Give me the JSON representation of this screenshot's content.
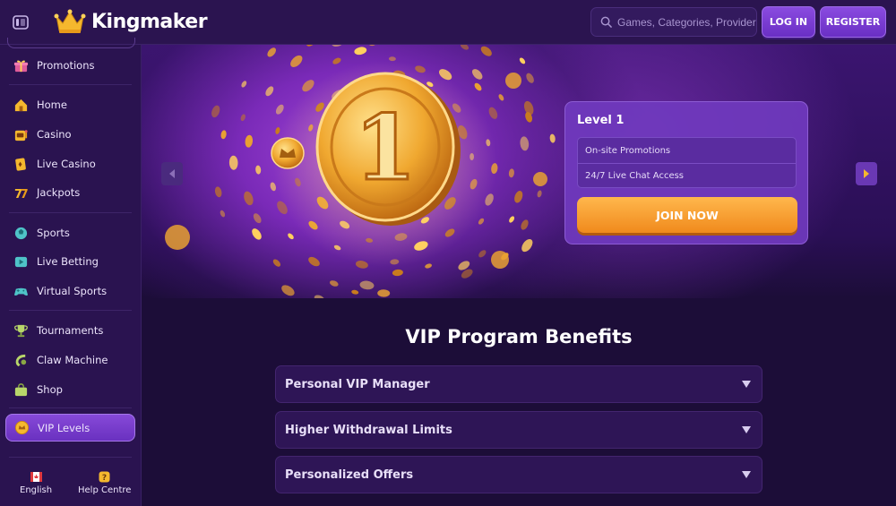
{
  "header": {
    "brand": "Kingmaker",
    "search_placeholder": "Games, Categories, Providers",
    "login_label": "LOG IN",
    "register_label": "REGISTER"
  },
  "sidebar": {
    "items": [
      {
        "label": "Promotions",
        "icon": "gift-icon"
      },
      {
        "label": "Home",
        "icon": "home-icon"
      },
      {
        "label": "Casino",
        "icon": "casino-icon"
      },
      {
        "label": "Live Casino",
        "icon": "live-casino-icon"
      },
      {
        "label": "Jackpots",
        "icon": "jackpots-icon"
      },
      {
        "label": "Sports",
        "icon": "sports-icon"
      },
      {
        "label": "Live Betting",
        "icon": "live-betting-icon"
      },
      {
        "label": "Virtual Sports",
        "icon": "gamepad-icon"
      },
      {
        "label": "Tournaments",
        "icon": "trophy-icon"
      },
      {
        "label": "Claw Machine",
        "icon": "claw-icon"
      },
      {
        "label": "Shop",
        "icon": "shop-icon"
      },
      {
        "label": "VIP Levels",
        "icon": "vip-coin-icon"
      }
    ],
    "footer": {
      "language_label": "English",
      "help_label": "Help Centre"
    }
  },
  "banner": {
    "coin_number": "1",
    "level_title": "Level 1",
    "perks": [
      "On-site Promotions",
      "24/7 Live Chat Access"
    ],
    "cta_label": "JOIN NOW"
  },
  "benefits": {
    "title": "VIP Program Benefits",
    "items": [
      "Personal VIP Manager",
      "Higher Withdrawal Limits",
      "Personalized Offers"
    ]
  },
  "colors": {
    "accent": "#7a3fd4",
    "cta": "#f5a033",
    "background": "#1c0d38"
  }
}
